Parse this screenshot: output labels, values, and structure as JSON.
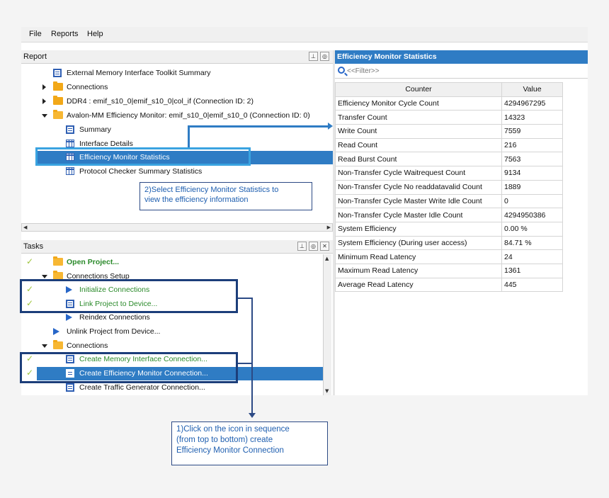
{
  "menu": {
    "file": "File",
    "reports": "Reports",
    "help": "Help"
  },
  "report_panel": {
    "title": "Report",
    "pin_icon": "pin-icon",
    "float_icon": "float-icon",
    "tree": [
      {
        "label": "External Memory Interface Toolkit Summary",
        "icon": "document-icon"
      },
      {
        "label": "Connections",
        "icon": "folder-icon"
      },
      {
        "label": "DDR4 : emif_s10_0|emif_s10_0|col_if (Connection ID: 2)",
        "icon": "folder-icon"
      },
      {
        "label": "Avalon-MM Efficiency Monitor: emif_s10_0|emif_s10_0 (Connection ID: 0)",
        "icon": "folder-open-icon"
      },
      {
        "label": "Summary",
        "icon": "document-icon"
      },
      {
        "label": "Interface Details",
        "icon": "grid-icon"
      },
      {
        "label": "Efficiency Monitor Statistics",
        "icon": "grid-icon"
      },
      {
        "label": "Protocol Checker Summary Statistics",
        "icon": "grid-icon"
      }
    ]
  },
  "tasks_panel": {
    "title": "Tasks",
    "open_project": "Open Project...",
    "connections_setup": "Connections Setup",
    "initialize": "Initialize Connections",
    "link": "Link Project to Device...",
    "reindex": "Reindex Connections",
    "unlink": "Unlink Project from Device...",
    "connections": "Connections",
    "create_memory": "Create Memory Interface Connection...",
    "create_efficiency": "Create Efficiency Monitor Connection...",
    "create_traffic": "Create Traffic Generator Connection..."
  },
  "stats_panel": {
    "title": "Efficiency Monitor Statistics",
    "filter_placeholder": "<<Filter>>",
    "columns": [
      "Counter",
      "Value"
    ],
    "rows": [
      [
        "Efficiency Monitor Cycle Count",
        "4294967295"
      ],
      [
        "Transfer Count",
        "14323"
      ],
      [
        "Write Count",
        "7559"
      ],
      [
        "Read Count",
        "216"
      ],
      [
        "Read Burst Count",
        "7563"
      ],
      [
        "Non-Transfer Cycle Waitrequest Count",
        "9134"
      ],
      [
        "Non-Transfer Cycle No readdatavalid Count",
        "1889"
      ],
      [
        "Non-Transfer Cycle Master Write Idle Count",
        "0"
      ],
      [
        "Non-Transfer Cycle Master Idle Count",
        "4294950386"
      ],
      [
        "System Efficiency",
        "0.00 %"
      ],
      [
        "System Efficiency (During user access)",
        "84.71 %"
      ],
      [
        "Minimum Read Latency",
        "24"
      ],
      [
        "Maximum Read Latency",
        "1361"
      ],
      [
        "Average Read Latency",
        "445"
      ]
    ]
  },
  "annotations": {
    "step2_line1": "2)Select Efficiency Monitor Statistics  to",
    "step2_line2": "view the efficiency information",
    "step1_line1": "1)Click on the icon in sequence",
    "step1_line2": "(from top to bottom) create",
    "step1_line3": "Efficiency Monitor Connection"
  },
  "colors": {
    "selection": "#2f7cc4",
    "annotation_box": "#1c3e7a",
    "highlight_box": "#3aa3e0",
    "check": "#9cc43a",
    "task_link": "#2a8a2a"
  }
}
